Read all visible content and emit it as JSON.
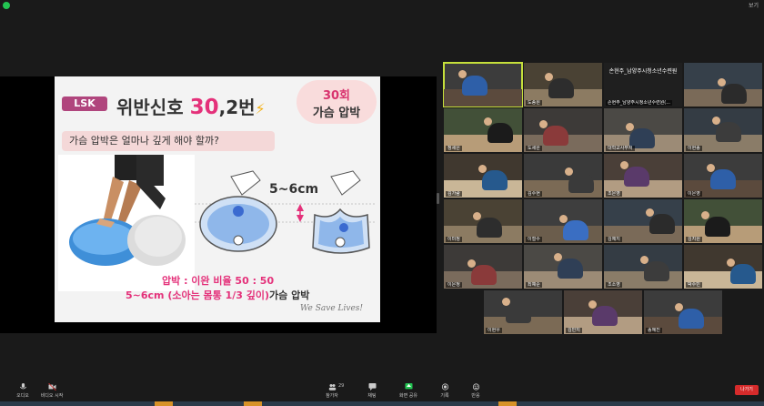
{
  "window": {
    "view_button": "보기"
  },
  "slide": {
    "logo": "LSK",
    "title_main": "위반신호 ",
    "title_number": "30",
    "title_suffix": ",2번",
    "bubble_line1": "30회",
    "bubble_line2": "가슴 압박",
    "question": "가슴 압박은 얼마나 깊게 해야 할까?",
    "depth_label": "5~6cm",
    "caption_ratio": "압박 : 이완 비율 50 : 50",
    "caption_depth": "5~6cm (소아는 몸통 1/3 깊이)",
    "caption_depth_tail": "가슴 압박",
    "signature": "We Save Lives!"
  },
  "gallery": {
    "tiles": [
      {
        "name": "",
        "active": true
      },
      {
        "name": "도종원"
      },
      {
        "name": "손현주_남양주시..."
      },
      {
        "name": ""
      },
      {
        "name": "정세은"
      },
      {
        "name": "도세완"
      },
      {
        "name": "대학교사무처"
      },
      {
        "name": "이현종"
      },
      {
        "name": "김가람"
      },
      {
        "name": "김수현"
      },
      {
        "name": "조은영"
      },
      {
        "name": "이은영"
      },
      {
        "name": "이미정"
      },
      {
        "name": "이철수"
      },
      {
        "name": "김예지"
      },
      {
        "name": "김지원"
      },
      {
        "name": "이은정"
      },
      {
        "name": "최예준"
      },
      {
        "name": "조소영"
      },
      {
        "name": "박수민"
      },
      {
        "name": "이현우"
      },
      {
        "name": "김민지"
      },
      {
        "name": "송혜진"
      },
      {
        "name": "정세은"
      },
      {
        "name": "정가윤"
      },
      {
        "name": "정 주 대학교사무처"
      },
      {
        "name": "이주영"
      },
      {
        "name": "김현지"
      }
    ],
    "dark_tile_name": "손현주_남양주시청소년수련원",
    "dark_tile_sub": "손현주_남양주시청소년수련원(...",
    "green_avatar": "창엽"
  },
  "toolbar": {
    "audio": "오디오",
    "video": "비디오 시작",
    "participants": "참가자",
    "participants_count": "29",
    "chat": "채팅",
    "share": "화면 공유",
    "record": "기록",
    "reactions": "반응",
    "leave": "나가기"
  },
  "colors": {
    "accent_green": "#23c552",
    "leave_red": "#d62b2b",
    "active_outline": "#c6e03b"
  }
}
